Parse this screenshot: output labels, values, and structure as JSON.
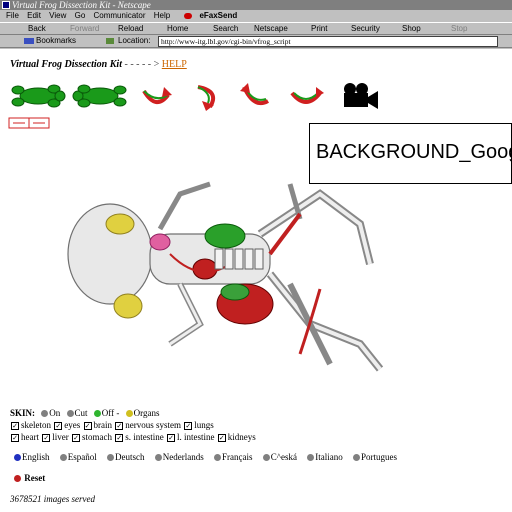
{
  "window": {
    "title": "Virtual Frog Dissection Kit - Netscape"
  },
  "menu": [
    "File",
    "Edit",
    "View",
    "Go",
    "Communicator",
    "Help"
  ],
  "efax": "eFaxSend",
  "toolbar": {
    "back": "Back",
    "forward": "Forward",
    "reload": "Reload",
    "home": "Home",
    "search": "Search",
    "netscape": "Netscape",
    "print": "Print",
    "security": "Security",
    "shop": "Shop",
    "stop": "Stop"
  },
  "location": {
    "bookmarks": "Bookmarks",
    "label": "Location:",
    "url": "http://www-itg.lbl.gov/cgi-bin/vfrog_script"
  },
  "page": {
    "title": "Virtual Frog Dissection Kit",
    "dashes": "- - - - - >",
    "help": "HELP"
  },
  "overlay": {
    "text": "BACKGROUND_Goog"
  },
  "skin": {
    "label": "SKIN:",
    "options": [
      "On",
      "Cut",
      "Off -",
      "Organs"
    ]
  },
  "organs": {
    "row1": [
      "skeleton",
      "eyes",
      "brain",
      "nervous system",
      "lungs"
    ],
    "row2": [
      "heart",
      "liver",
      "stomach",
      "s. intestine",
      "l. intestine",
      "kidneys"
    ]
  },
  "languages": [
    "English",
    "Español",
    "Deutsch",
    "Nederlands",
    "Français",
    "C^eská",
    "Italiano",
    "Portugues"
  ],
  "reset": "Reset",
  "served": "3678521 images served",
  "colors": {
    "accent_help": "#cc6600",
    "frog_green": "#1a9a1a",
    "arrow_red": "#d02020"
  }
}
